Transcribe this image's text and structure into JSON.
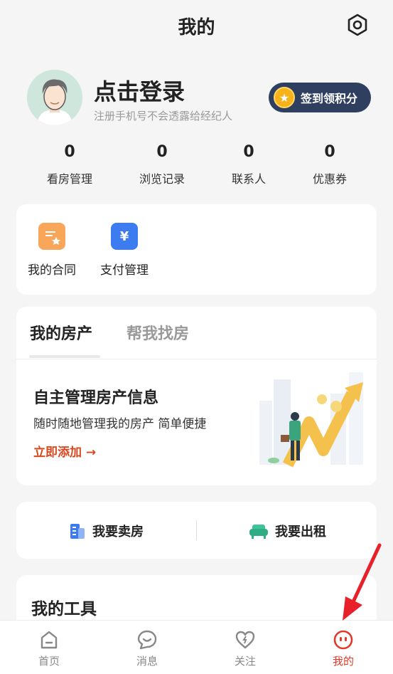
{
  "header": {
    "title": "我的",
    "settings_icon": "gear-icon"
  },
  "profile": {
    "login_label": "点击登录",
    "subtitle": "注册手机号不会透露给经纪人",
    "signin_label": "签到领积分",
    "signin_icon": "star-coin-icon"
  },
  "stats": [
    {
      "value": "0",
      "label": "看房管理"
    },
    {
      "value": "0",
      "label": "浏览记录"
    },
    {
      "value": "0",
      "label": "联系人"
    },
    {
      "value": "0",
      "label": "优惠券"
    }
  ],
  "services": [
    {
      "label": "我的合同",
      "icon": "contract-icon",
      "color": "#f7a65a"
    },
    {
      "label": "支付管理",
      "icon": "yen-ticket-icon",
      "color": "#3d7cf0"
    }
  ],
  "property": {
    "tabs": [
      "我的房产",
      "帮我找房"
    ],
    "title": "自主管理房产信息",
    "subtitle": "随时随地管理我的房产 简单便捷",
    "add_label": "立即添加 →"
  },
  "actions": [
    {
      "label": "我要卖房",
      "icon": "building-icon"
    },
    {
      "label": "我要出租",
      "icon": "sofa-icon"
    }
  ],
  "tools": {
    "title": "我的工具"
  },
  "tabbar": [
    {
      "label": "首页",
      "icon": "home-icon"
    },
    {
      "label": "消息",
      "icon": "message-icon"
    },
    {
      "label": "关注",
      "icon": "heart-icon"
    },
    {
      "label": "我的",
      "icon": "profile-face-icon",
      "active": true
    }
  ],
  "colors": {
    "accent": "#e03a2a",
    "signin_bg": "#2f3f5f"
  }
}
